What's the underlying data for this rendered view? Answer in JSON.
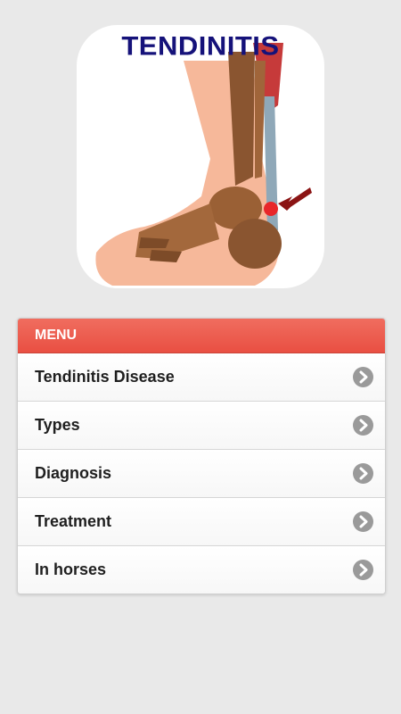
{
  "logo": {
    "title": "TENDINITIS",
    "image": "foot-ankle-bones-illustration"
  },
  "menu": {
    "header": "MENU",
    "items": [
      {
        "label": "Tendinitis Disease",
        "icon": "chevron-right-icon"
      },
      {
        "label": "Types",
        "icon": "chevron-right-icon"
      },
      {
        "label": "Diagnosis",
        "icon": "chevron-right-icon"
      },
      {
        "label": "Treatment",
        "icon": "chevron-right-icon"
      },
      {
        "label": "In horses",
        "icon": "chevron-right-icon"
      }
    ]
  },
  "colors": {
    "background": "#e9e9e9",
    "menu_header": "#ec5a4d",
    "title": "#15127a",
    "chevron": "#9a9a9a"
  }
}
